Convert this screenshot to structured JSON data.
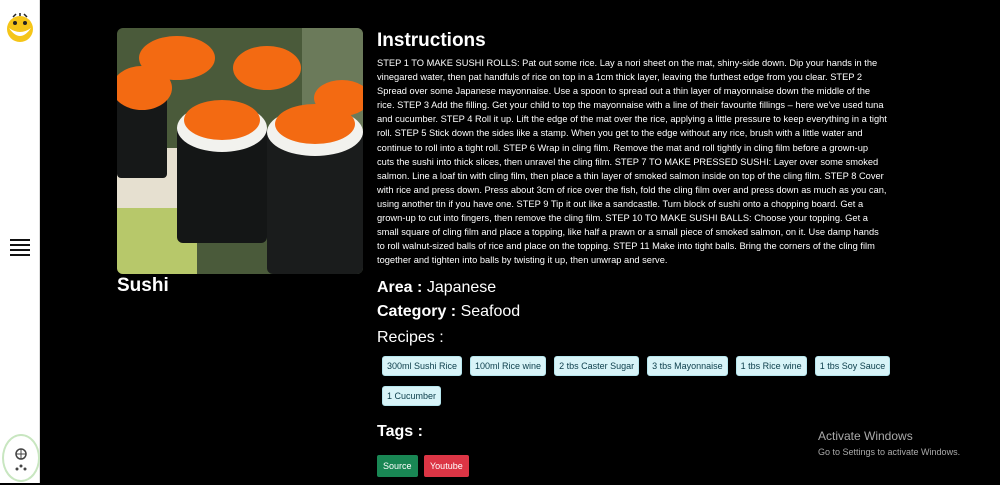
{
  "sidebar": {
    "logo_icon": "smiley-logo-icon",
    "menu_icon": "hamburger-menu-icon",
    "accessibility_icon": "accessibility-widget-icon"
  },
  "meal": {
    "name": "Sushi",
    "instructions_title": "Instructions",
    "instructions": "STEP 1 TO MAKE SUSHI ROLLS: Pat out some rice. Lay a nori sheet on the mat, shiny-side down. Dip your hands in the vinegared water, then pat handfuls of rice on top in a 1cm thick layer, leaving the furthest edge from you clear. STEP 2 Spread over some Japanese mayonnaise. Use a spoon to spread out a thin layer of mayonnaise down the middle of the rice. STEP 3 Add the filling. Get your child to top the mayonnaise with a line of their favourite fillings – here we've used tuna and cucumber. STEP 4 Roll it up. Lift the edge of the mat over the rice, applying a little pressure to keep everything in a tight roll. STEP 5 Stick down the sides like a stamp. When you get to the edge without any rice, brush with a little water and continue to roll into a tight roll. STEP 6 Wrap in cling film. Remove the mat and roll tightly in cling film before a grown-up cuts the sushi into thick slices, then unravel the cling film. STEP 7 TO MAKE PRESSED SUSHI: Layer over some smoked salmon. Line a loaf tin with cling film, then place a thin layer of smoked salmon inside on top of the cling film. STEP 8 Cover with rice and press down. Press about 3cm of rice over the fish, fold the cling film over and press down as much as you can, using another tin if you have one. STEP 9 Tip it out like a sandcastle. Turn block of sushi onto a chopping board. Get a grown-up to cut into fingers, then remove the cling film. STEP 10 TO MAKE SUSHI BALLS: Choose your topping. Get a small square of cling film and place a topping, like half a prawn or a small piece of smoked salmon, on it. Use damp hands to roll walnut-sized balls of rice and place on the topping. STEP 11 Make into tight balls. Bring the corners of the cling film together and tighten into balls by twisting it up, then unwrap and serve.",
    "area_label": "Area :",
    "area_value": "Japanese",
    "category_label": "Category :",
    "category_value": "Seafood",
    "recipes_label": "Recipes :",
    "ingredients": [
      "300ml Sushi Rice",
      "100ml Rice wine",
      "2 tbs Caster Sugar",
      "3 tbs Mayonnaise",
      "1 tbs Rice wine",
      "1 tbs Soy Sauce",
      "1 Cucumber"
    ],
    "tags_label": "Tags :",
    "source_label": "Source",
    "youtube_label": "Youtube"
  },
  "colors": {
    "source_button": "#198754",
    "youtube_button": "#dc3545",
    "chip_bg": "#d8f4f8"
  },
  "watermark": {
    "title": "Activate Windows",
    "subtitle": "Go to Settings to activate Windows."
  }
}
